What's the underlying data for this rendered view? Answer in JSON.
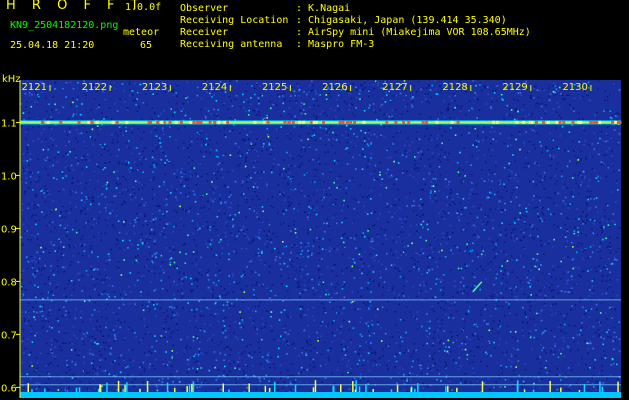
{
  "header": {
    "app_title": "H R O F F T",
    "version": "1.0.0f",
    "filename": "KN9_2504182120.png",
    "mode_label": "meteor",
    "datetime": "25.04.18 21:20",
    "count": "65",
    "meta_labels": [
      "Observer",
      "Receiving Location",
      "Receiver",
      "Receiving antenna"
    ],
    "meta_values": [
      ": K.Nagai",
      ": Chigasaki, Japan (139.414 35.340)",
      ": AirSpy mini (Miakejima VOR 108.65MHz)",
      ": Maspro FM-3"
    ]
  },
  "colors": {
    "background": "#000000",
    "text": "#ffff00",
    "spectrogram_base": "#1a2f9e",
    "bottom_band": "#00c8ff"
  },
  "chart_data": {
    "type": "heatmap",
    "ylabel": "kHz",
    "y_ticks": [
      "1.1",
      "1.0",
      "0.9",
      "0.8",
      "0.7",
      "0.6"
    ],
    "x_ticks": [
      "2121",
      "2122",
      "2123",
      "2124",
      "2125",
      "2126",
      "2127",
      "2128",
      "2129",
      "2130"
    ],
    "ylim": [
      0.58,
      1.18
    ],
    "xlim": [
      2120.5,
      2130.5
    ],
    "features": [
      {
        "kind": "carrier",
        "y": 1.1
      },
      {
        "kind": "faint_line",
        "y": 0.765
      },
      {
        "kind": "faint_line",
        "y": 0.62
      },
      {
        "kind": "faint_line",
        "y": 0.605
      }
    ],
    "meteor_echo": {
      "x": 2128.1,
      "y": 0.79
    }
  }
}
